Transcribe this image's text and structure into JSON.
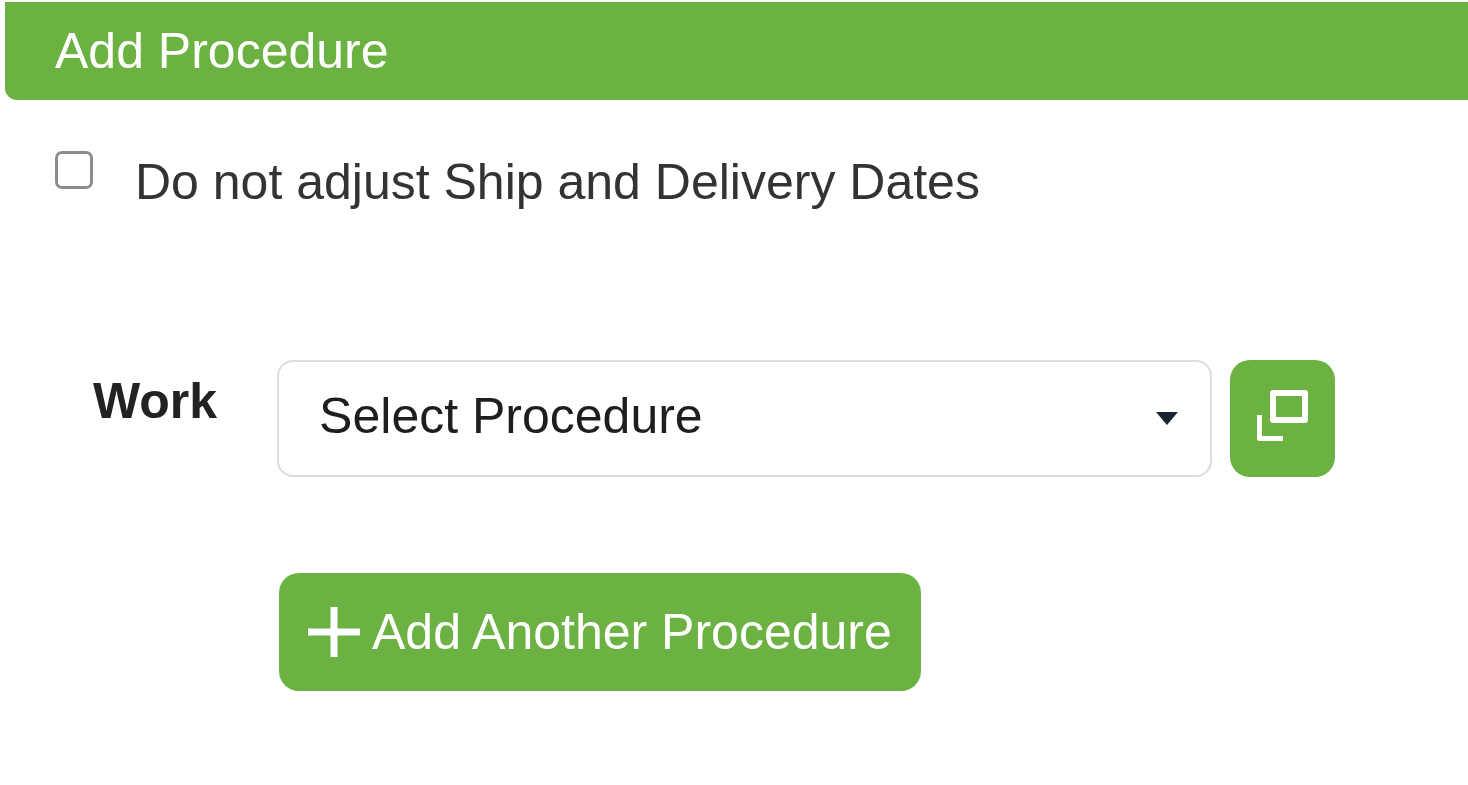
{
  "panel": {
    "title": "Add Procedure"
  },
  "options": [
    {
      "label": "Do not adjust Ship and Delivery Dates",
      "checked": false
    }
  ],
  "procedures": [
    {
      "label": "Work",
      "value": "Select Procedure"
    }
  ],
  "add_button": {
    "label": "Add Another Procedure"
  }
}
